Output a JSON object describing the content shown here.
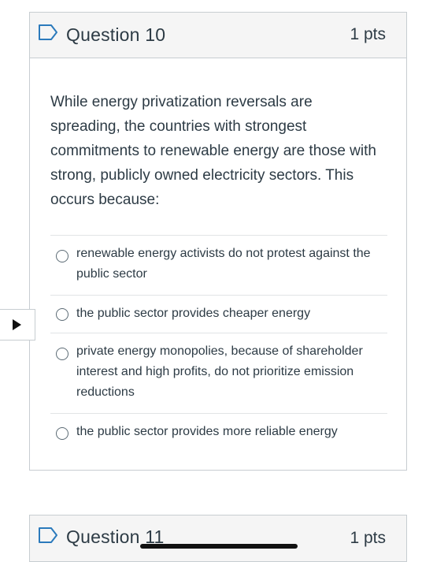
{
  "question": {
    "title": "Question 10",
    "points": "1 pts",
    "text": "While energy privatization reversals are spreading, the countries with strongest commitments to renewable energy are those with strong, publicly owned electricity sectors. This occurs because:",
    "flag_icon": "bookmark-flag-icon",
    "answers": [
      {
        "label": "renewable energy activists do not protest against the public sector",
        "selected": false
      },
      {
        "label": "the public sector provides cheaper energy",
        "selected": false
      },
      {
        "label": "private energy monopolies, because of shareholder interest and high profits, do not prioritize emission reductions",
        "selected": false
      },
      {
        "label": "the public sector provides more reliable energy",
        "selected": false
      }
    ]
  },
  "next_question": {
    "title": "Question 11",
    "points": "1 pts"
  },
  "side_tab": {
    "icon": "play-triangle-icon"
  },
  "colors": {
    "text": "#2d3b45",
    "border": "#c7cdd1",
    "header_bg": "#f5f5f5",
    "flag_accent": "#2b7abc"
  }
}
